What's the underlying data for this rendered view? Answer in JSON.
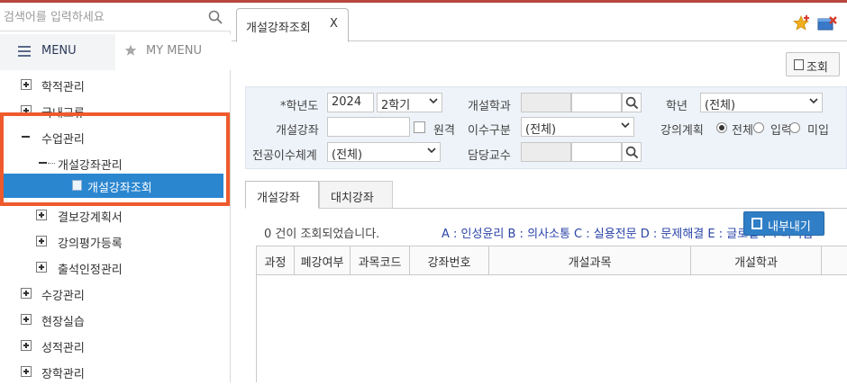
{
  "sidebar": {
    "search": {
      "placeholder": "검색어를 입력하세요"
    },
    "tabs": {
      "menu": "MENU",
      "mymenu": "MY MENU"
    },
    "tree": [
      {
        "label": "학적관리"
      },
      {
        "label": "국내교류"
      },
      {
        "label": "수업관리"
      },
      {
        "label": "개설강좌관리"
      },
      {
        "label": "개설강좌조회"
      },
      {
        "label": "결보강계획서"
      },
      {
        "label": "강의평가등록"
      },
      {
        "label": "출석인정관리"
      },
      {
        "label": "수강관리"
      },
      {
        "label": "현장실습"
      },
      {
        "label": "성적관리"
      },
      {
        "label": "장학관리"
      }
    ]
  },
  "tabbar": {
    "active_tab": "개설강좌조회",
    "close": "X"
  },
  "toolbar": {
    "search_label": "조회"
  },
  "filters": {
    "year_label": "*학년도",
    "year_value": "2024",
    "term_value": "2학기",
    "dept_label": "개설학과",
    "grade_label": "학년",
    "grade_value": "(전체)",
    "course_label": "개설강좌",
    "remote_label": "원격",
    "completion_label": "이수구분",
    "completion_value": "(전체)",
    "plan_label": "강의계획",
    "plan_options": [
      "전체",
      "입력",
      "미입"
    ],
    "major_label": "전공이수체계",
    "major_value": "(전체)",
    "professor_label": "담당교수"
  },
  "results": {
    "tabs": [
      "개설강좌",
      "대치강좌"
    ],
    "count_text": "0 건이 조회되었습니다.",
    "legend": "A : 인성윤리 B : 의사소통 C : 실용전문 D : 문제해결 E : 글로벌 F : 리더십",
    "export_label": "내부내기",
    "columns": [
      "과정",
      "폐강여부",
      "과목코드",
      "강좌번호",
      "개설과목",
      "개설학과"
    ]
  },
  "colors": {
    "selected": "#2b86d0",
    "highlight": "#ee5a2c",
    "accent": "#2f7ec6"
  }
}
